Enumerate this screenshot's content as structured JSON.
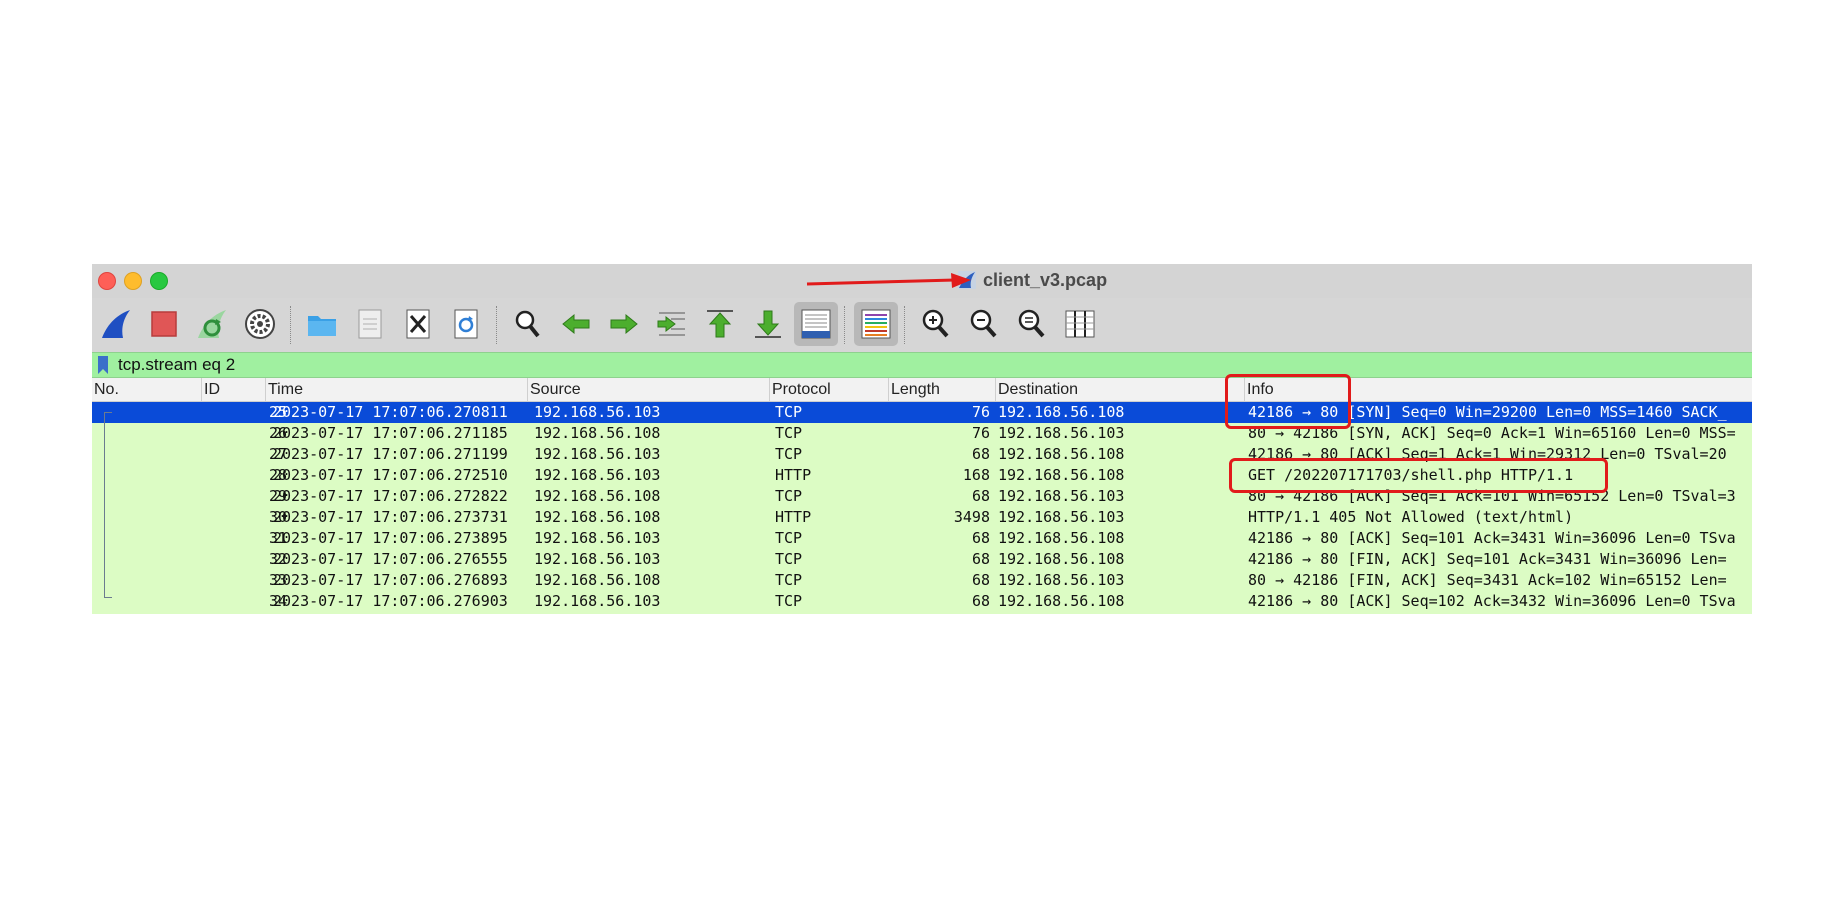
{
  "window": {
    "title": "client_v3.pcap",
    "traffic_lights": [
      "close",
      "minimize",
      "maximize"
    ]
  },
  "toolbar": {
    "buttons": [
      {
        "name": "start-capture-icon",
        "color": "#1f4fc2"
      },
      {
        "name": "stop-capture-icon",
        "color": "#e05656"
      },
      {
        "name": "restart-capture-icon",
        "color": "#3aa84b"
      },
      {
        "name": "capture-options-icon",
        "color": "#555555"
      },
      {
        "name": "open-file-icon",
        "color": "#3aa0e6"
      },
      {
        "name": "save-file-icon",
        "color": "#8a8a8a"
      },
      {
        "name": "close-file-icon",
        "color": "#333333"
      },
      {
        "name": "reload-file-icon",
        "color": "#2f7fd6"
      },
      {
        "name": "find-packet-icon",
        "color": "#333333"
      },
      {
        "name": "go-back-icon",
        "color": "#4cae2e"
      },
      {
        "name": "go-forward-icon",
        "color": "#4cae2e"
      },
      {
        "name": "go-to-packet-icon",
        "color": "#4cae2e"
      },
      {
        "name": "go-first-packet-icon",
        "color": "#4cae2e"
      },
      {
        "name": "go-last-packet-icon",
        "color": "#4cae2e"
      },
      {
        "name": "auto-scroll-icon",
        "color": "#2f5fb0"
      },
      {
        "name": "colorize-icon",
        "color": "#c0392b"
      },
      {
        "name": "zoom-in-icon",
        "color": "#333333"
      },
      {
        "name": "zoom-out-icon",
        "color": "#333333"
      },
      {
        "name": "normal-size-icon",
        "color": "#333333"
      },
      {
        "name": "resize-columns-icon",
        "color": "#333333"
      }
    ]
  },
  "filter": {
    "value": "tcp.stream eq 2",
    "background": "#a0f0a0"
  },
  "columns": {
    "no": "No.",
    "id": "ID",
    "time": "Time",
    "source": "Source",
    "protocol": "Protocol",
    "length": "Length",
    "destination": "Destination",
    "info": "Info"
  },
  "rows": [
    {
      "no": "25",
      "time": "2023-07-17 17:07:06.270811",
      "src": "192.168.56.103",
      "proto": "TCP",
      "len": "76",
      "dst": "192.168.56.108",
      "info": "42186 → 80 [SYN] Seq=0 Win=29200 Len=0 MSS=1460 SACK_",
      "selected": true
    },
    {
      "no": "26",
      "time": "2023-07-17 17:07:06.271185",
      "src": "192.168.56.108",
      "proto": "TCP",
      "len": "76",
      "dst": "192.168.56.103",
      "info": "80 → 42186 [SYN, ACK] Seq=0 Ack=1 Win=65160 Len=0 MSS=",
      "selected": false
    },
    {
      "no": "27",
      "time": "2023-07-17 17:07:06.271199",
      "src": "192.168.56.103",
      "proto": "TCP",
      "len": "68",
      "dst": "192.168.56.108",
      "info": "42186 → 80 [ACK] Seq=1 Ack=1 Win=29312 Len=0 TSval=20",
      "selected": false
    },
    {
      "no": "28",
      "time": "2023-07-17 17:07:06.272510",
      "src": "192.168.56.103",
      "proto": "HTTP",
      "len": "168",
      "dst": "192.168.56.108",
      "info": "GET /202207171703/shell.php HTTP/1.1",
      "selected": false
    },
    {
      "no": "29",
      "time": "2023-07-17 17:07:06.272822",
      "src": "192.168.56.108",
      "proto": "TCP",
      "len": "68",
      "dst": "192.168.56.103",
      "info": "80 → 42186 [ACK] Seq=1 Ack=101 Win=65152 Len=0 TSval=3",
      "selected": false
    },
    {
      "no": "30",
      "time": "2023-07-17 17:07:06.273731",
      "src": "192.168.56.108",
      "proto": "HTTP",
      "len": "3498",
      "dst": "192.168.56.103",
      "info": "HTTP/1.1 405 Not Allowed  (text/html)",
      "selected": false
    },
    {
      "no": "31",
      "time": "2023-07-17 17:07:06.273895",
      "src": "192.168.56.103",
      "proto": "TCP",
      "len": "68",
      "dst": "192.168.56.108",
      "info": "42186 → 80 [ACK] Seq=101 Ack=3431 Win=36096 Len=0 TSva",
      "selected": false
    },
    {
      "no": "32",
      "time": "2023-07-17 17:07:06.276555",
      "src": "192.168.56.103",
      "proto": "TCP",
      "len": "68",
      "dst": "192.168.56.108",
      "info": "42186 → 80 [FIN, ACK] Seq=101 Ack=3431 Win=36096 Len=",
      "selected": false
    },
    {
      "no": "33",
      "time": "2023-07-17 17:07:06.276893",
      "src": "192.168.56.108",
      "proto": "TCP",
      "len": "68",
      "dst": "192.168.56.103",
      "info": "80 → 42186 [FIN, ACK] Seq=3431 Ack=102 Win=65152 Len=",
      "selected": false
    },
    {
      "no": "34",
      "time": "2023-07-17 17:07:06.276903",
      "src": "192.168.56.103",
      "proto": "TCP",
      "len": "68",
      "dst": "192.168.56.108",
      "info": "42186 → 80 [ACK] Seq=102 Ack=3432 Win=36096 Len=0 TSva",
      "selected": false
    }
  ],
  "colors": {
    "row_background": "#dcfcc4",
    "selected_row": "#0a4bd8",
    "annotation": "#e11b1b"
  }
}
